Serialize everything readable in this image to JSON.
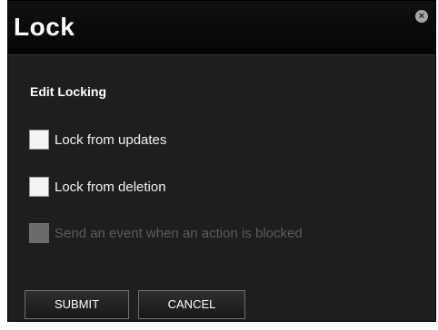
{
  "dialog": {
    "title": "Lock",
    "close_icon": "close-icon",
    "section_title": "Edit Locking",
    "options": [
      {
        "label": "Lock from updates",
        "checked": false,
        "disabled": false
      },
      {
        "label": "Lock from deletion",
        "checked": false,
        "disabled": false
      },
      {
        "label": "Send an event when an action is blocked",
        "checked": false,
        "disabled": true
      }
    ],
    "buttons": {
      "submit": "SUBMIT",
      "cancel": "CANCEL"
    }
  },
  "colors": {
    "background": "#1e1e1e",
    "header": "#0b0b0b",
    "text": "#ffffff",
    "disabled_text": "#5c5c5c",
    "checkbox": "#f4f4f4"
  }
}
